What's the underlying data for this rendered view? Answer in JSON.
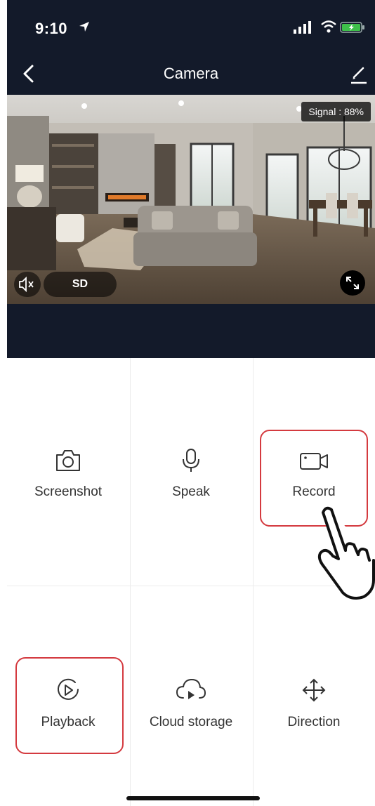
{
  "status_bar": {
    "time": "9:10",
    "icons": [
      "location-arrow-icon",
      "signal-bars-icon",
      "wifi-icon",
      "battery-charging-icon"
    ]
  },
  "nav": {
    "title": "Camera",
    "back_icon": "chevron-left-icon",
    "edit_icon": "pencil-icon"
  },
  "camera": {
    "signal_label": "Signal : 88%",
    "quality_label": "SD",
    "mute_icon": "speaker-muted-icon",
    "fullscreen_icon": "fullscreen-icon"
  },
  "controls": [
    {
      "label": "Screenshot",
      "icon": "camera-icon"
    },
    {
      "label": "Speak",
      "icon": "microphone-icon"
    },
    {
      "label": "Record",
      "icon": "video-camera-icon"
    },
    {
      "label": "Playback",
      "icon": "play-circle-icon"
    },
    {
      "label": "Cloud storage",
      "icon": "cloud-play-icon"
    },
    {
      "label": "Direction",
      "icon": "move-arrows-icon"
    }
  ],
  "colors": {
    "dark_bg": "#131a2a",
    "highlight": "#d43a3f",
    "text": "#333333"
  }
}
